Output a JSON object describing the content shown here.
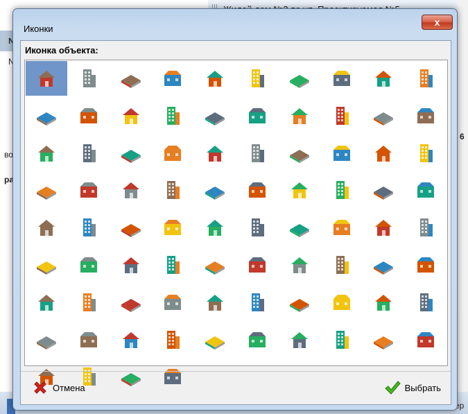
{
  "background": {
    "title": "Жилой дом №2 по ул. Проектируемая №5",
    "left_fragments": [
      "№",
      "N",
      "во",
      "ра"
    ],
    "right_fragments": [
      "6",
      "ер"
    ]
  },
  "dialog": {
    "title": "Иконки",
    "close_label": "x",
    "section_label": "Иконка объекта:",
    "cancel_label": "Отмена",
    "select_label": "Выбрать"
  },
  "icons": [
    "construction-crane-building-icon",
    "factory-red-icon",
    "colorful-buildings-icon",
    "blue-office-buildings-icon",
    "tall-blue-building-icon",
    "brown-house-icon",
    "red-roof-house-icon",
    "orange-house-icon",
    "cottage-icon",
    "green-glass-tower-icon",
    "blue-office-complex-icon",
    "green-apartments-icon",
    "castle-icon",
    "red-brick-apartments-icon",
    "fire-station-icon",
    "dark-brick-block-icon",
    "green-mint-building-icon",
    "green-tower-icon",
    "blue-office-icon",
    "orange-house-trees-icon",
    "capitol-dome-icon",
    "grey-office-icon",
    "white-highrise-icon",
    "round-blue-tower-icon",
    "blue-office-block-icon",
    "pink-apartments-icon",
    "blue-window-building-icon",
    "satellite-station-icon",
    "shop-icon",
    "dollar-bank-icon",
    "bank-columns-icon",
    "hospital-icon",
    "green-pavilion-icon",
    "shop-awning-icon",
    "warehouse-icon",
    "barrier-gate-icon",
    "flag-office-icon",
    "brown-shop-icon",
    "townhouse-icon",
    "yellow-tower-icon",
    "green-roof-house-icon",
    "striped-apartments-icon",
    "dark-pavilion-icon",
    "brick-hotel-icon",
    "modern-glass-building-icon",
    "hotel-icon",
    "blue-roof-house-icon",
    "grey-dome-building-icon",
    "white-pavilion-icon",
    "green-tent-icon",
    "orange-shed-icon",
    "blue-hangar-icon",
    "small-factory-icon",
    "factory-chimney-icon",
    "blue-factory-icon",
    "industrial-plant-icon",
    "red-factory-icon",
    "orange-pipes-icon",
    "grey-tanks-icon",
    "gas-storage-icon",
    "brick-ruins-icon",
    "grey-silos-icon",
    "brick-church-icon",
    "cathedral-icon",
    "green-farm-icon",
    "green-garden-icon",
    "statue-icon",
    "stadium-icon",
    "football-field-icon",
    "oil-rig-icon",
    "oil-pump-icon",
    "radio-tower-icon",
    "satellite-dish-icon",
    "gas-valve-icon",
    "water-pipe-icon",
    "power-pylon-icon",
    "lattice-tower-icon",
    "railway-station-icon",
    "road-segment-icon",
    "curved-road-icon",
    "railway-track-icon",
    "rail-bridge-icon",
    "metro-station-icon",
    "wooden-bridge-icon"
  ]
}
